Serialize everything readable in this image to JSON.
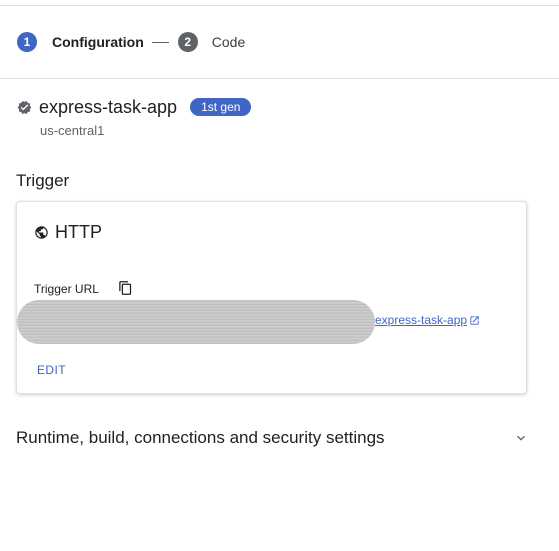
{
  "stepper": {
    "steps": [
      {
        "number": "1",
        "label": "Configuration"
      },
      {
        "number": "2",
        "label": "Code"
      }
    ]
  },
  "function": {
    "name": "express-task-app",
    "generation_badge": "1st gen",
    "region": "us-central1",
    "status_icon": "check-circle-icon"
  },
  "trigger": {
    "section_title": "Trigger",
    "type": "HTTP",
    "type_icon": "globe-icon",
    "url_label": "Trigger URL",
    "url_visible_suffix": "express-task-app",
    "edit_label": "EDIT"
  },
  "settings": {
    "label": "Runtime, build, connections and security settings"
  },
  "colors": {
    "accent": "#3f66c4",
    "inactive_step": "#5f6368",
    "text_primary": "#202124",
    "text_secondary": "#5f6368"
  }
}
